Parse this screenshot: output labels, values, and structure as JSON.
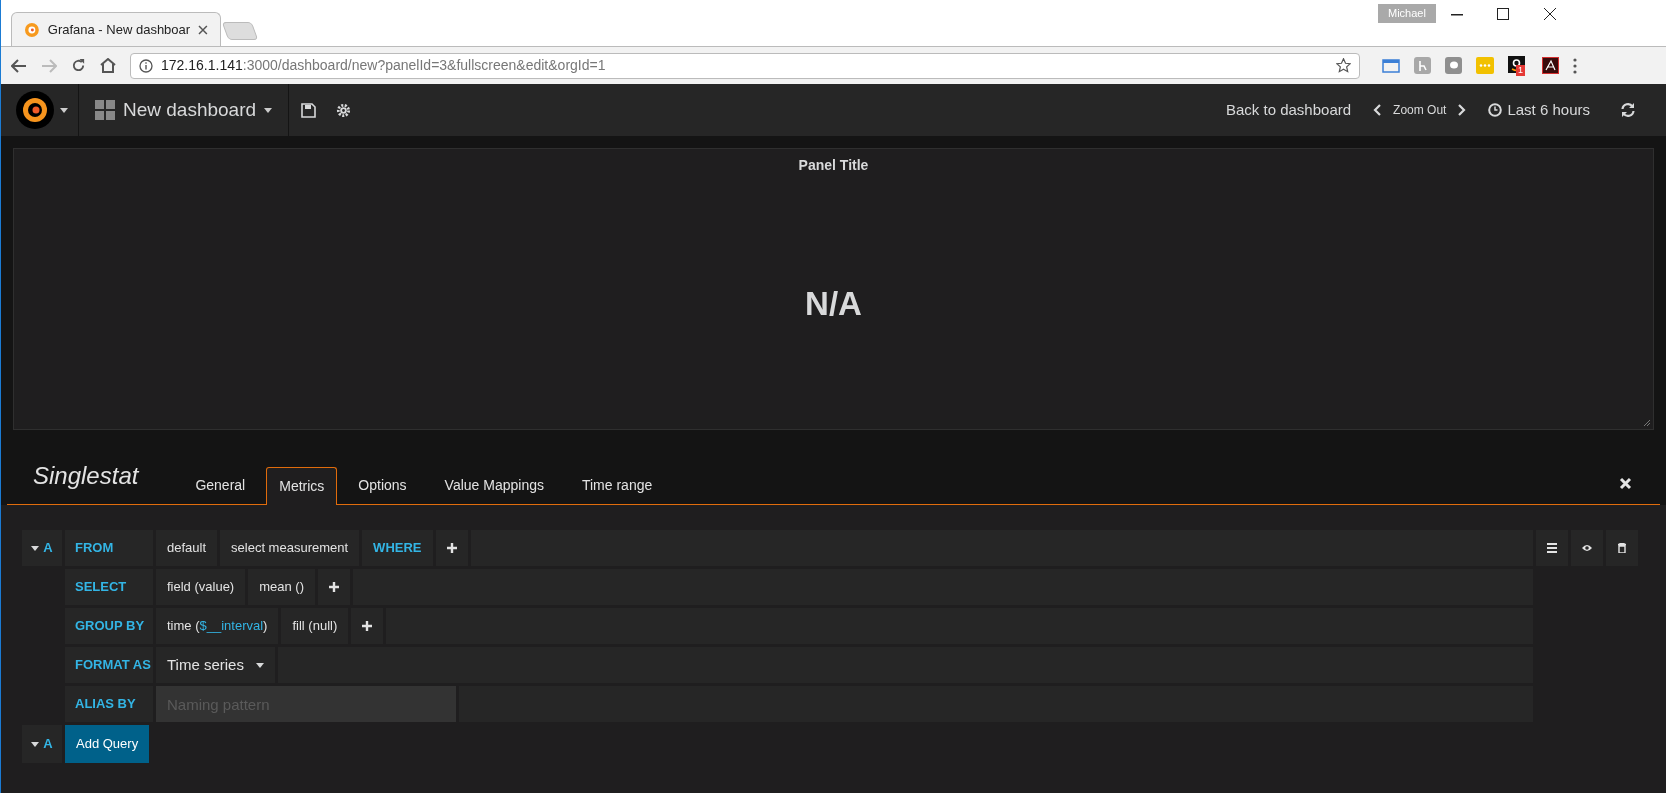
{
  "browser": {
    "tab_title": "Grafana - New dashboar",
    "profile": "Michael",
    "url_host": "172.16.1.141",
    "url_rest": ":3000/dashboard/new?panelId=3&fullscreen&edit&orgId=1",
    "extension_badge": "1"
  },
  "navbar": {
    "dashboard_title": "New dashboard",
    "back": "Back to dashboard",
    "zoom_out": "Zoom Out",
    "time_range": "Last 6 hours"
  },
  "panel": {
    "title": "Panel Title",
    "value": "N/A"
  },
  "editor": {
    "title": "Singlestat",
    "tabs": [
      {
        "label": "General",
        "selected": false
      },
      {
        "label": "Metrics",
        "selected": true
      },
      {
        "label": "Options",
        "selected": false
      },
      {
        "label": "Value Mappings",
        "selected": false
      },
      {
        "label": "Time range",
        "selected": false
      }
    ]
  },
  "query": {
    "ref": "A",
    "rows": [
      {
        "label": "FROM",
        "segments": [
          {
            "kind": "value",
            "parts": [
              {
                "text": "default",
                "variable": false
              }
            ]
          },
          {
            "kind": "value",
            "parts": [
              {
                "text": "select measurement",
                "variable": false
              }
            ]
          },
          {
            "kind": "keyword",
            "text": "WHERE"
          },
          {
            "kind": "plus"
          }
        ]
      },
      {
        "label": "SELECT",
        "segments": [
          {
            "kind": "value",
            "parts": [
              {
                "text": "field (value)",
                "variable": false
              }
            ]
          },
          {
            "kind": "value",
            "parts": [
              {
                "text": "mean ()",
                "variable": false
              }
            ]
          },
          {
            "kind": "plus"
          }
        ]
      },
      {
        "label": "GROUP BY",
        "segments": [
          {
            "kind": "value",
            "parts": [
              {
                "text": "time (",
                "variable": false
              },
              {
                "text": "$__interval",
                "variable": true
              },
              {
                "text": ")",
                "variable": false
              }
            ]
          },
          {
            "kind": "value",
            "parts": [
              {
                "text": "fill (null)",
                "variable": false
              }
            ]
          },
          {
            "kind": "plus"
          }
        ]
      },
      {
        "label": "FORMAT AS",
        "segments": [
          {
            "kind": "dropdown",
            "parts": [
              {
                "text": "Time series",
                "variable": false
              }
            ]
          }
        ]
      },
      {
        "label": "ALIAS BY",
        "segments": [
          {
            "kind": "input",
            "placeholder": "Naming pattern"
          }
        ]
      }
    ]
  },
  "add_query": {
    "ref": "A",
    "label": "Add Query"
  }
}
